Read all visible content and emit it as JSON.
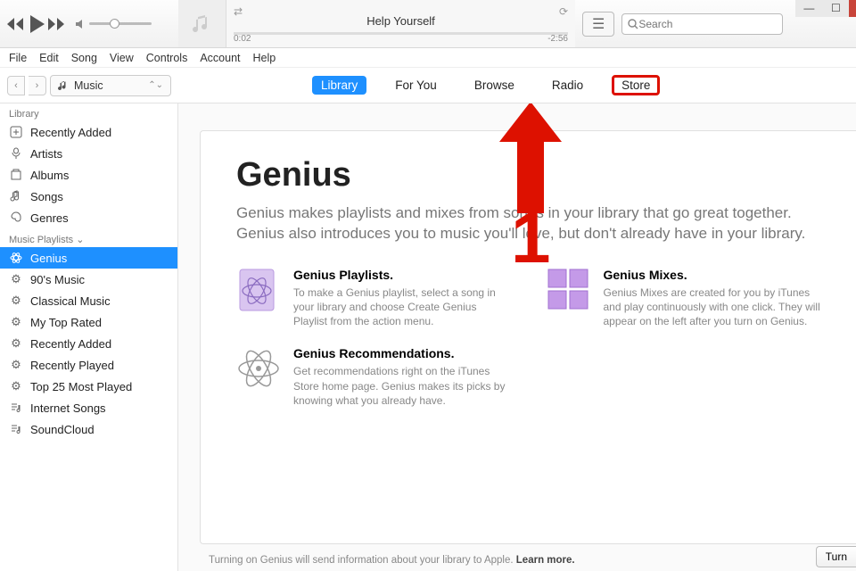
{
  "player": {
    "now_playing_title": "Help Yourself",
    "time_elapsed": "0:02",
    "time_remaining": "-2:56"
  },
  "search": {
    "placeholder": "Search"
  },
  "menu": [
    "File",
    "Edit",
    "Song",
    "View",
    "Controls",
    "Account",
    "Help"
  ],
  "category": {
    "label": "Music"
  },
  "tabs": [
    {
      "label": "Library",
      "active": true
    },
    {
      "label": "For You"
    },
    {
      "label": "Browse"
    },
    {
      "label": "Radio"
    },
    {
      "label": "Store",
      "boxed": true
    }
  ],
  "sidebar": {
    "sections": [
      {
        "header": "Library",
        "items": [
          {
            "icon": "recently-added",
            "label": "Recently Added"
          },
          {
            "icon": "artists",
            "label": "Artists"
          },
          {
            "icon": "albums",
            "label": "Albums"
          },
          {
            "icon": "songs",
            "label": "Songs"
          },
          {
            "icon": "genres",
            "label": "Genres"
          }
        ]
      },
      {
        "header": "Music Playlists",
        "collapsible": true,
        "items": [
          {
            "icon": "genius",
            "label": "Genius",
            "selected": true
          },
          {
            "icon": "gear",
            "label": "90's Music"
          },
          {
            "icon": "gear",
            "label": "Classical Music"
          },
          {
            "icon": "gear",
            "label": "My Top Rated"
          },
          {
            "icon": "gear",
            "label": "Recently Added"
          },
          {
            "icon": "gear",
            "label": "Recently Played"
          },
          {
            "icon": "gear",
            "label": "Top 25 Most Played"
          },
          {
            "icon": "playlist",
            "label": "Internet Songs"
          },
          {
            "icon": "playlist",
            "label": "SoundCloud"
          }
        ]
      }
    ]
  },
  "panel": {
    "title": "Genius",
    "lead1": "Genius makes playlists and mixes from songs in your library that go great together.",
    "lead2": "Genius also introduces you to music you'll love, but don't already have in your library.",
    "features": [
      {
        "title": "Genius Playlists.",
        "desc": "To make a Genius playlist, select a song in your library and choose Create Genius Playlist from the action menu."
      },
      {
        "title": "Genius Mixes.",
        "desc": "Genius Mixes are created for you by iTunes and play continuously with one click. They will appear on the left after you turn on Genius."
      },
      {
        "title": "Genius Recommendations.",
        "desc": "Get recommendations right on the iTunes Store home page. Genius makes its picks by knowing what you already have."
      }
    ],
    "footer": "Turning on Genius will send information about your library to Apple.",
    "footer_link": "Learn more",
    "turn_button": "Turn"
  },
  "annotation": {
    "number": "1"
  }
}
